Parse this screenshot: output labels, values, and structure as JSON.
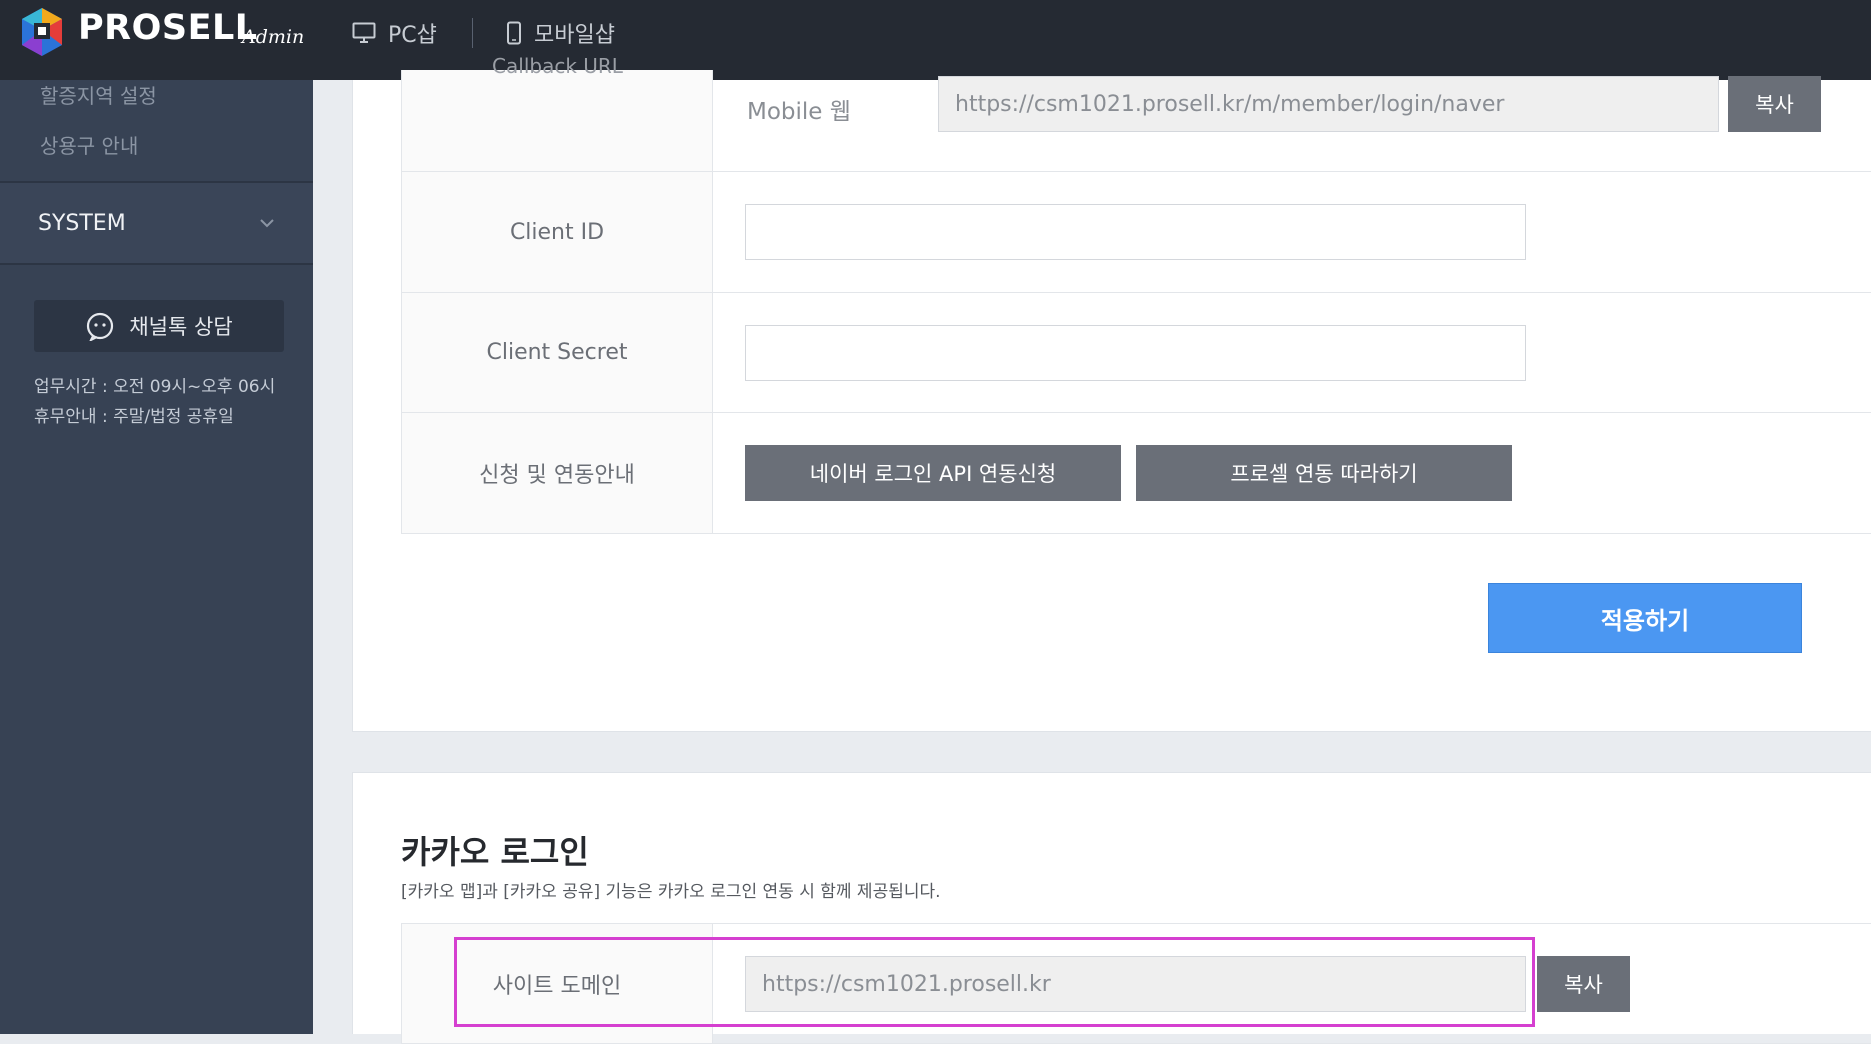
{
  "brand": {
    "name": "PROSELL",
    "suffix": "Admin"
  },
  "topnav": {
    "pc_shop": "PC샵",
    "mobile_shop": "모바일샵"
  },
  "sidebar": {
    "links": [
      "할증지역 설정",
      "상용구 안내"
    ],
    "system_label": "SYSTEM",
    "chat_button": "채널톡 상담",
    "hours": "업무시간 : 오전 09시~오후 06시",
    "holidays": "휴무안내 : 주말/법정 공휴일"
  },
  "naver": {
    "callback_label": "Callback URL",
    "mobile_web_label": "Mobile 웹",
    "mobile_web_url": "https://csm1021.prosell.kr/m/member/login/naver",
    "copy_label": "복사",
    "client_id_label": "Client ID",
    "client_id_value": "",
    "client_secret_label": "Client Secret",
    "client_secret_value": "",
    "apply_guide_label": "신청 및 연동안내",
    "api_request_button": "네이버 로그인 API 연동신청",
    "follow_button": "프로셀 연동 따라하기",
    "apply_button": "적용하기"
  },
  "kakao": {
    "title": "카카오 로그인",
    "description": "[카카오 맵]과 [카카오 공유] 기능은 카카오 로그인 연동 시 함께 제공됩니다.",
    "site_domain_label": "사이트 도메인",
    "site_domain_value": "https://csm1021.prosell.kr",
    "copy_label": "복사"
  },
  "colors": {
    "topbar": "#252a33",
    "sidebar": "#374254",
    "primary": "#4b97f2",
    "gray_button": "#6a6f78",
    "highlight": "#d53fd0"
  }
}
